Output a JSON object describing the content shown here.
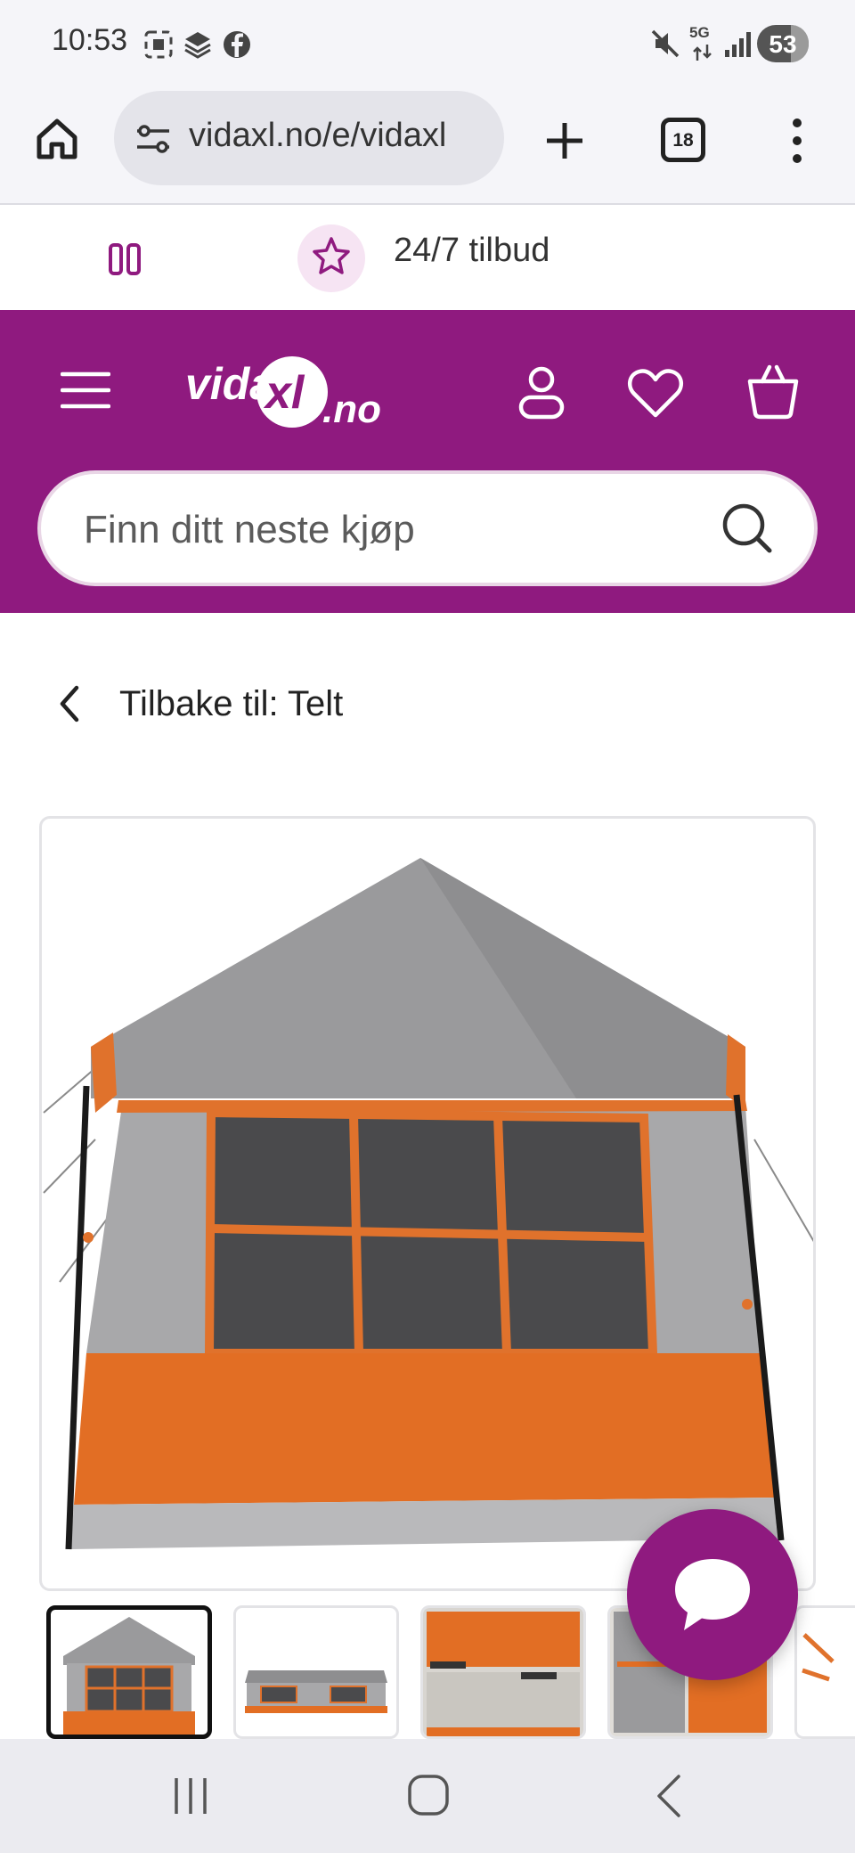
{
  "status_bar": {
    "time": "10:53",
    "battery": "53",
    "network": "5G",
    "icons": [
      "screenshot-icon",
      "layers-icon",
      "facebook-icon",
      "mute-icon",
      "signal-icon",
      "battery-icon"
    ]
  },
  "browser": {
    "url": "vidaxl.no/e/vidaxl",
    "tab_count": "18",
    "icons": [
      "home-icon",
      "site-settings-icon",
      "new-tab-icon",
      "tabs-icon",
      "more-menu-icon"
    ]
  },
  "promo": {
    "text": "24/7 tilbud"
  },
  "header": {
    "logo_text": "vidaXL.no",
    "search_placeholder": "Finn ditt neste kjøp",
    "brand_color": "#8f1a7f"
  },
  "breadcrumb": {
    "back_label": "Tilbake til: Telt"
  },
  "product": {
    "thumbnails": [
      "thumbnail-1",
      "thumbnail-2",
      "thumbnail-3",
      "thumbnail-4"
    ]
  }
}
